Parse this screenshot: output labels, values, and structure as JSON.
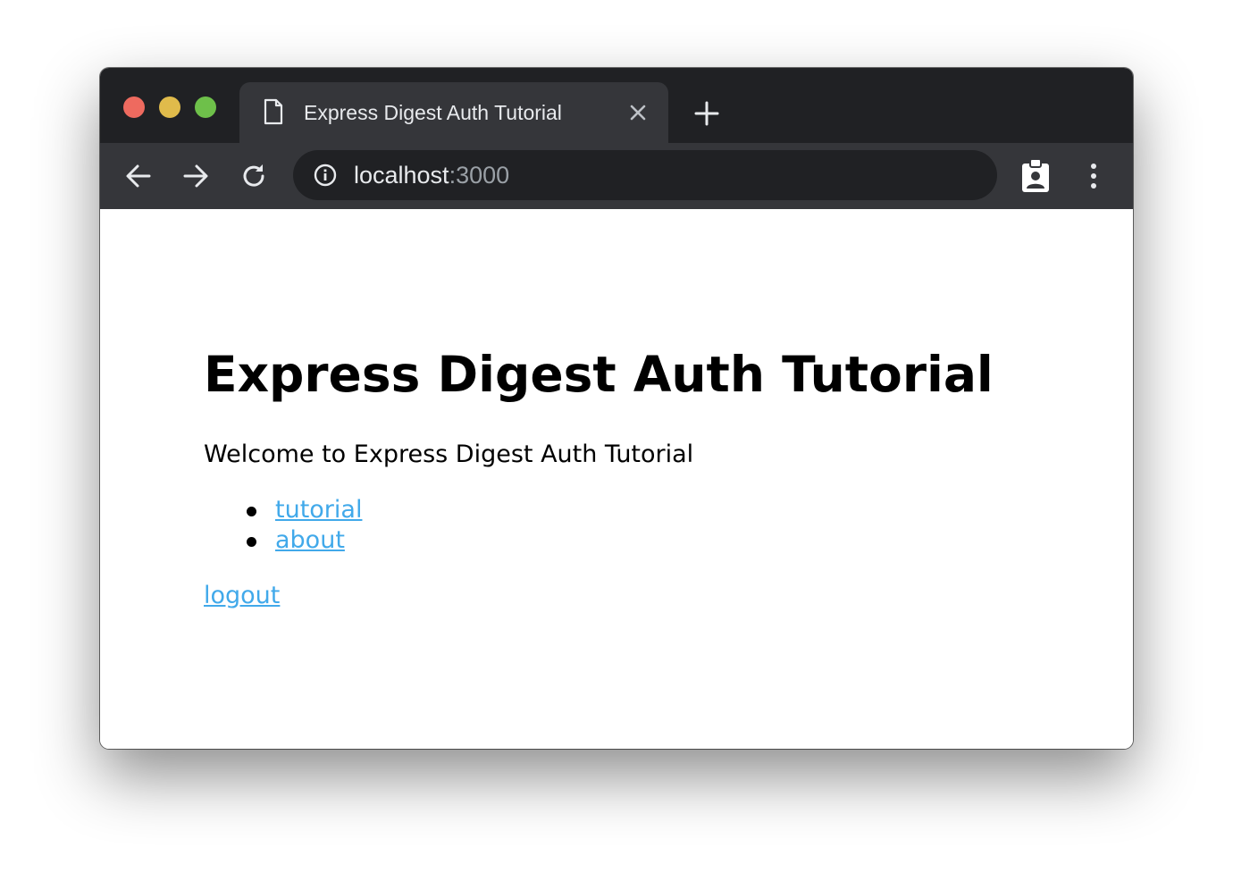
{
  "browser": {
    "tab": {
      "title": "Express Digest Auth Tutorial",
      "close_icon": "close-icon",
      "doc_icon": "document-icon"
    },
    "new_tab_icon": "plus-icon",
    "address_bar": {
      "host": "localhost",
      "port": ":3000",
      "security_icon": "info-icon"
    },
    "toolbar_icons": [
      "back-arrow-icon",
      "forward-arrow-icon",
      "reload-icon",
      "badge-icon",
      "kebab-menu-icon"
    ],
    "colors": {
      "titlebar": "#202124",
      "toolbar": "#35363a",
      "omnibox": "#202124",
      "traffic_red": "#ee6a5f",
      "traffic_yellow": "#e0bb4b",
      "traffic_green": "#6ec04a"
    }
  },
  "page": {
    "heading": "Express Digest Auth Tutorial",
    "welcome": "Welcome to Express Digest Auth Tutorial",
    "links": [
      {
        "label": "tutorial"
      },
      {
        "label": "about"
      }
    ],
    "logout": "logout",
    "link_color": "#41a9ea"
  }
}
